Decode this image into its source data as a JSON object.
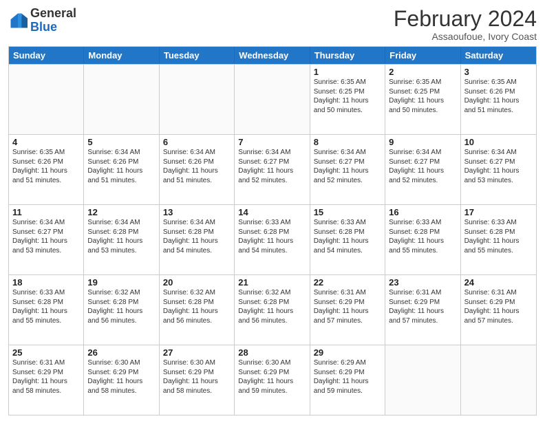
{
  "logo": {
    "general": "General",
    "blue": "Blue"
  },
  "title": "February 2024",
  "subtitle": "Assaoufoue, Ivory Coast",
  "headers": [
    "Sunday",
    "Monday",
    "Tuesday",
    "Wednesday",
    "Thursday",
    "Friday",
    "Saturday"
  ],
  "weeks": [
    [
      {
        "day": "",
        "info": ""
      },
      {
        "day": "",
        "info": ""
      },
      {
        "day": "",
        "info": ""
      },
      {
        "day": "",
        "info": ""
      },
      {
        "day": "1",
        "info": "Sunrise: 6:35 AM\nSunset: 6:25 PM\nDaylight: 11 hours\nand 50 minutes."
      },
      {
        "day": "2",
        "info": "Sunrise: 6:35 AM\nSunset: 6:25 PM\nDaylight: 11 hours\nand 50 minutes."
      },
      {
        "day": "3",
        "info": "Sunrise: 6:35 AM\nSunset: 6:26 PM\nDaylight: 11 hours\nand 51 minutes."
      }
    ],
    [
      {
        "day": "4",
        "info": "Sunrise: 6:35 AM\nSunset: 6:26 PM\nDaylight: 11 hours\nand 51 minutes."
      },
      {
        "day": "5",
        "info": "Sunrise: 6:34 AM\nSunset: 6:26 PM\nDaylight: 11 hours\nand 51 minutes."
      },
      {
        "day": "6",
        "info": "Sunrise: 6:34 AM\nSunset: 6:26 PM\nDaylight: 11 hours\nand 51 minutes."
      },
      {
        "day": "7",
        "info": "Sunrise: 6:34 AM\nSunset: 6:27 PM\nDaylight: 11 hours\nand 52 minutes."
      },
      {
        "day": "8",
        "info": "Sunrise: 6:34 AM\nSunset: 6:27 PM\nDaylight: 11 hours\nand 52 minutes."
      },
      {
        "day": "9",
        "info": "Sunrise: 6:34 AM\nSunset: 6:27 PM\nDaylight: 11 hours\nand 52 minutes."
      },
      {
        "day": "10",
        "info": "Sunrise: 6:34 AM\nSunset: 6:27 PM\nDaylight: 11 hours\nand 53 minutes."
      }
    ],
    [
      {
        "day": "11",
        "info": "Sunrise: 6:34 AM\nSunset: 6:27 PM\nDaylight: 11 hours\nand 53 minutes."
      },
      {
        "day": "12",
        "info": "Sunrise: 6:34 AM\nSunset: 6:28 PM\nDaylight: 11 hours\nand 53 minutes."
      },
      {
        "day": "13",
        "info": "Sunrise: 6:34 AM\nSunset: 6:28 PM\nDaylight: 11 hours\nand 54 minutes."
      },
      {
        "day": "14",
        "info": "Sunrise: 6:33 AM\nSunset: 6:28 PM\nDaylight: 11 hours\nand 54 minutes."
      },
      {
        "day": "15",
        "info": "Sunrise: 6:33 AM\nSunset: 6:28 PM\nDaylight: 11 hours\nand 54 minutes."
      },
      {
        "day": "16",
        "info": "Sunrise: 6:33 AM\nSunset: 6:28 PM\nDaylight: 11 hours\nand 55 minutes."
      },
      {
        "day": "17",
        "info": "Sunrise: 6:33 AM\nSunset: 6:28 PM\nDaylight: 11 hours\nand 55 minutes."
      }
    ],
    [
      {
        "day": "18",
        "info": "Sunrise: 6:33 AM\nSunset: 6:28 PM\nDaylight: 11 hours\nand 55 minutes."
      },
      {
        "day": "19",
        "info": "Sunrise: 6:32 AM\nSunset: 6:28 PM\nDaylight: 11 hours\nand 56 minutes."
      },
      {
        "day": "20",
        "info": "Sunrise: 6:32 AM\nSunset: 6:28 PM\nDaylight: 11 hours\nand 56 minutes."
      },
      {
        "day": "21",
        "info": "Sunrise: 6:32 AM\nSunset: 6:28 PM\nDaylight: 11 hours\nand 56 minutes."
      },
      {
        "day": "22",
        "info": "Sunrise: 6:31 AM\nSunset: 6:29 PM\nDaylight: 11 hours\nand 57 minutes."
      },
      {
        "day": "23",
        "info": "Sunrise: 6:31 AM\nSunset: 6:29 PM\nDaylight: 11 hours\nand 57 minutes."
      },
      {
        "day": "24",
        "info": "Sunrise: 6:31 AM\nSunset: 6:29 PM\nDaylight: 11 hours\nand 57 minutes."
      }
    ],
    [
      {
        "day": "25",
        "info": "Sunrise: 6:31 AM\nSunset: 6:29 PM\nDaylight: 11 hours\nand 58 minutes."
      },
      {
        "day": "26",
        "info": "Sunrise: 6:30 AM\nSunset: 6:29 PM\nDaylight: 11 hours\nand 58 minutes."
      },
      {
        "day": "27",
        "info": "Sunrise: 6:30 AM\nSunset: 6:29 PM\nDaylight: 11 hours\nand 58 minutes."
      },
      {
        "day": "28",
        "info": "Sunrise: 6:30 AM\nSunset: 6:29 PM\nDaylight: 11 hours\nand 59 minutes."
      },
      {
        "day": "29",
        "info": "Sunrise: 6:29 AM\nSunset: 6:29 PM\nDaylight: 11 hours\nand 59 minutes."
      },
      {
        "day": "",
        "info": ""
      },
      {
        "day": "",
        "info": ""
      }
    ]
  ]
}
